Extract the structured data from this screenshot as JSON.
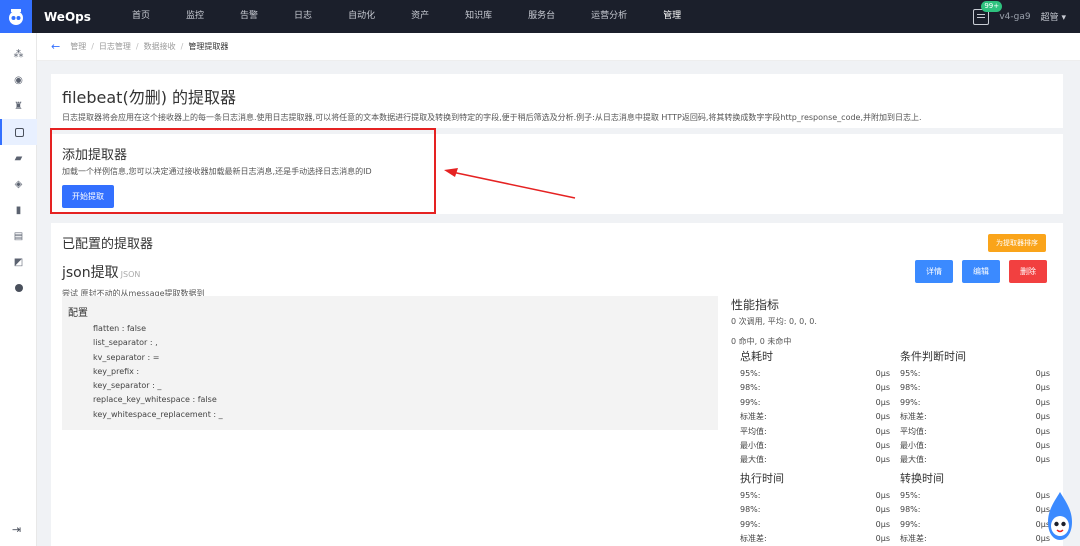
{
  "topbar": {
    "brand": "WeOps",
    "nav": [
      "首页",
      "监控",
      "告警",
      "日志",
      "自动化",
      "资产",
      "知识库",
      "服务台",
      "运营分析",
      "管理"
    ],
    "active_nav": "管理",
    "badge": "99+",
    "version": "v4-ga9",
    "user": "超管"
  },
  "breadcrumb": {
    "items": [
      "管理",
      "日志管理",
      "数据接收",
      "管理提取器"
    ]
  },
  "header": {
    "title": "filebeat(勿删) 的提取器",
    "description": "日志提取器将会应用在这个接收器上的每一条日志消息.使用日志提取器,可以将任意的文本数据进行提取及转换到特定的字段,便于稍后筛选及分析.例子:从日志消息中提取 HTTP返回码,将其转换成数字字段http_response_code,并附加到日志上."
  },
  "add_section": {
    "title": "添加提取器",
    "description": "加载一个样例信息,您可以决定通过接收器加载最新日志消息,还是手动选择日志消息的ID",
    "button": "开始提取"
  },
  "configured": {
    "title": "已配置的提取器",
    "sort_button": "为提取器排序",
    "extractor": {
      "name": "json提取",
      "type": "JSON",
      "description": "尝试 原封不动的从message提取数据到",
      "buttons": {
        "detail": "详情",
        "edit": "编辑",
        "delete": "删除"
      },
      "config_title": "配置",
      "config": [
        "flatten : false",
        "list_separator : ,",
        "kv_separator : =",
        "key_prefix :",
        "key_separator : _",
        "replace_key_whitespace : false",
        "key_whitespace_replacement : _"
      ]
    },
    "performance": {
      "title": "性能指标",
      "line1": "0 次调用, 平均: 0, 0, 0.",
      "line2": "0 命中, 0 未命中",
      "groups": [
        {
          "title": "总耗时",
          "rows": [
            [
              "95%:",
              "0μs"
            ],
            [
              "98%:",
              "0μs"
            ],
            [
              "99%:",
              "0μs"
            ],
            [
              "标准差:",
              "0μs"
            ],
            [
              "平均值:",
              "0μs"
            ],
            [
              "最小值:",
              "0μs"
            ],
            [
              "最大值:",
              "0μs"
            ]
          ]
        },
        {
          "title": "条件判断时间",
          "rows": [
            [
              "95%:",
              "0μs"
            ],
            [
              "98%:",
              "0μs"
            ],
            [
              "99%:",
              "0μs"
            ],
            [
              "标准差:",
              "0μs"
            ],
            [
              "平均值:",
              "0μs"
            ],
            [
              "最小值:",
              "0μs"
            ],
            [
              "最大值:",
              "0μs"
            ]
          ]
        },
        {
          "title": "执行时间",
          "rows": [
            [
              "95%:",
              "0μs"
            ],
            [
              "98%:",
              "0μs"
            ],
            [
              "99%:",
              "0μs"
            ],
            [
              "标准差:",
              "0μs"
            ]
          ]
        },
        {
          "title": "转换时间",
          "rows": [
            [
              "95%:",
              "0μs"
            ],
            [
              "98%:",
              "0μs"
            ],
            [
              "99%:",
              "0μs"
            ],
            [
              "标准差:",
              "0μs"
            ]
          ]
        }
      ]
    }
  }
}
